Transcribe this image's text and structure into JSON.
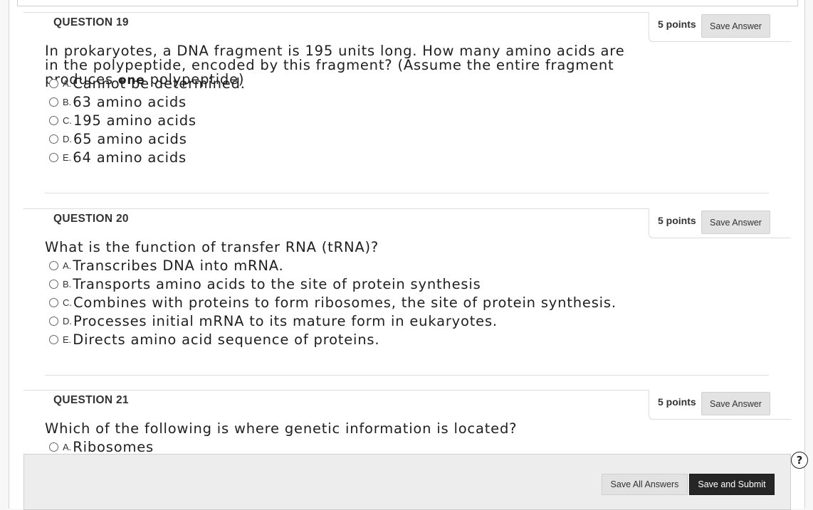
{
  "points_label": "5 points",
  "save_answer_label": "Save Answer",
  "questions": [
    {
      "title": "QUESTION 19",
      "text_before_bold": "In prokaryotes, a DNA fragment is 195 units long. How many amino acids are in the polypeptide, encoded by this fragment? (Assume the entire fragment produces ",
      "text_bold": "one",
      "text_after_bold": " polypeptide)",
      "choices": [
        {
          "letter": "A.",
          "text": "Cannot be determined."
        },
        {
          "letter": "B.",
          "text": "63 amino acids"
        },
        {
          "letter": "C.",
          "text": "195 amino acids"
        },
        {
          "letter": "D.",
          "text": "65 amino acids"
        },
        {
          "letter": "E.",
          "text": "64 amino acids"
        }
      ]
    },
    {
      "title": "QUESTION 20",
      "text": "What is the function of transfer RNA (tRNA)?",
      "choices": [
        {
          "letter": "A.",
          "text": "Transcribes DNA into mRNA."
        },
        {
          "letter": "B.",
          "text": "Transports amino acids to the site of protein synthesis"
        },
        {
          "letter": "C.",
          "text": "Combines with proteins to form ribosomes, the site of protein synthesis."
        },
        {
          "letter": "D.",
          "text": "Processes initial mRNA to its mature form in eukaryotes."
        },
        {
          "letter": "E.",
          "text": "Directs amino acid sequence of proteins."
        }
      ]
    },
    {
      "title": "QUESTION 21",
      "text": "Which of the following is where genetic information is located?",
      "choices": [
        {
          "letter": "A.",
          "text": "Ribosomes"
        }
      ]
    }
  ],
  "footer": {
    "save_all_label": "Save All Answers",
    "submit_label": "Save and Submit"
  },
  "help_icon": "help-icon",
  "help_glyph": "?"
}
